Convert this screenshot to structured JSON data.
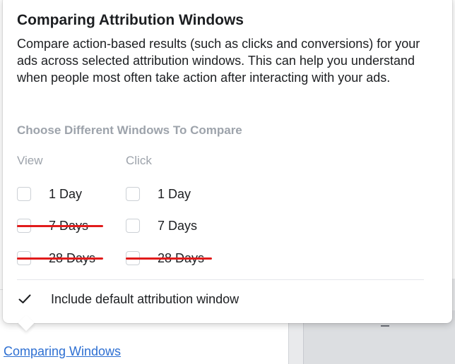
{
  "popover": {
    "title": "Comparing Attribution Windows",
    "description": "Compare action-based results (such as clicks and conversions) for your ads across selected attribution windows. This can help you understand when people most often take action after interacting with your ads.",
    "section_title": "Choose Different Windows To Compare",
    "columns": {
      "view": "View",
      "click": "Click"
    },
    "view_options": [
      {
        "label": "1 Day",
        "checked": false,
        "struck_out": false
      },
      {
        "label": "7 Days",
        "checked": false,
        "struck_out": true
      },
      {
        "label": "28 Days",
        "checked": false,
        "struck_out": true
      }
    ],
    "click_options": [
      {
        "label": "1 Day",
        "checked": false,
        "struck_out": false
      },
      {
        "label": "7 Days",
        "checked": false,
        "struck_out": false
      },
      {
        "label": "28 Days",
        "checked": false,
        "struck_out": true
      }
    ],
    "include_default": {
      "label": "Include default attribution window",
      "checked": true
    }
  },
  "link": {
    "label": "Comparing Windows"
  },
  "colors": {
    "strike": "#e11b1b",
    "link": "#2d6fd2",
    "muted_text": "#9da3ab",
    "text": "#1c1e21"
  }
}
